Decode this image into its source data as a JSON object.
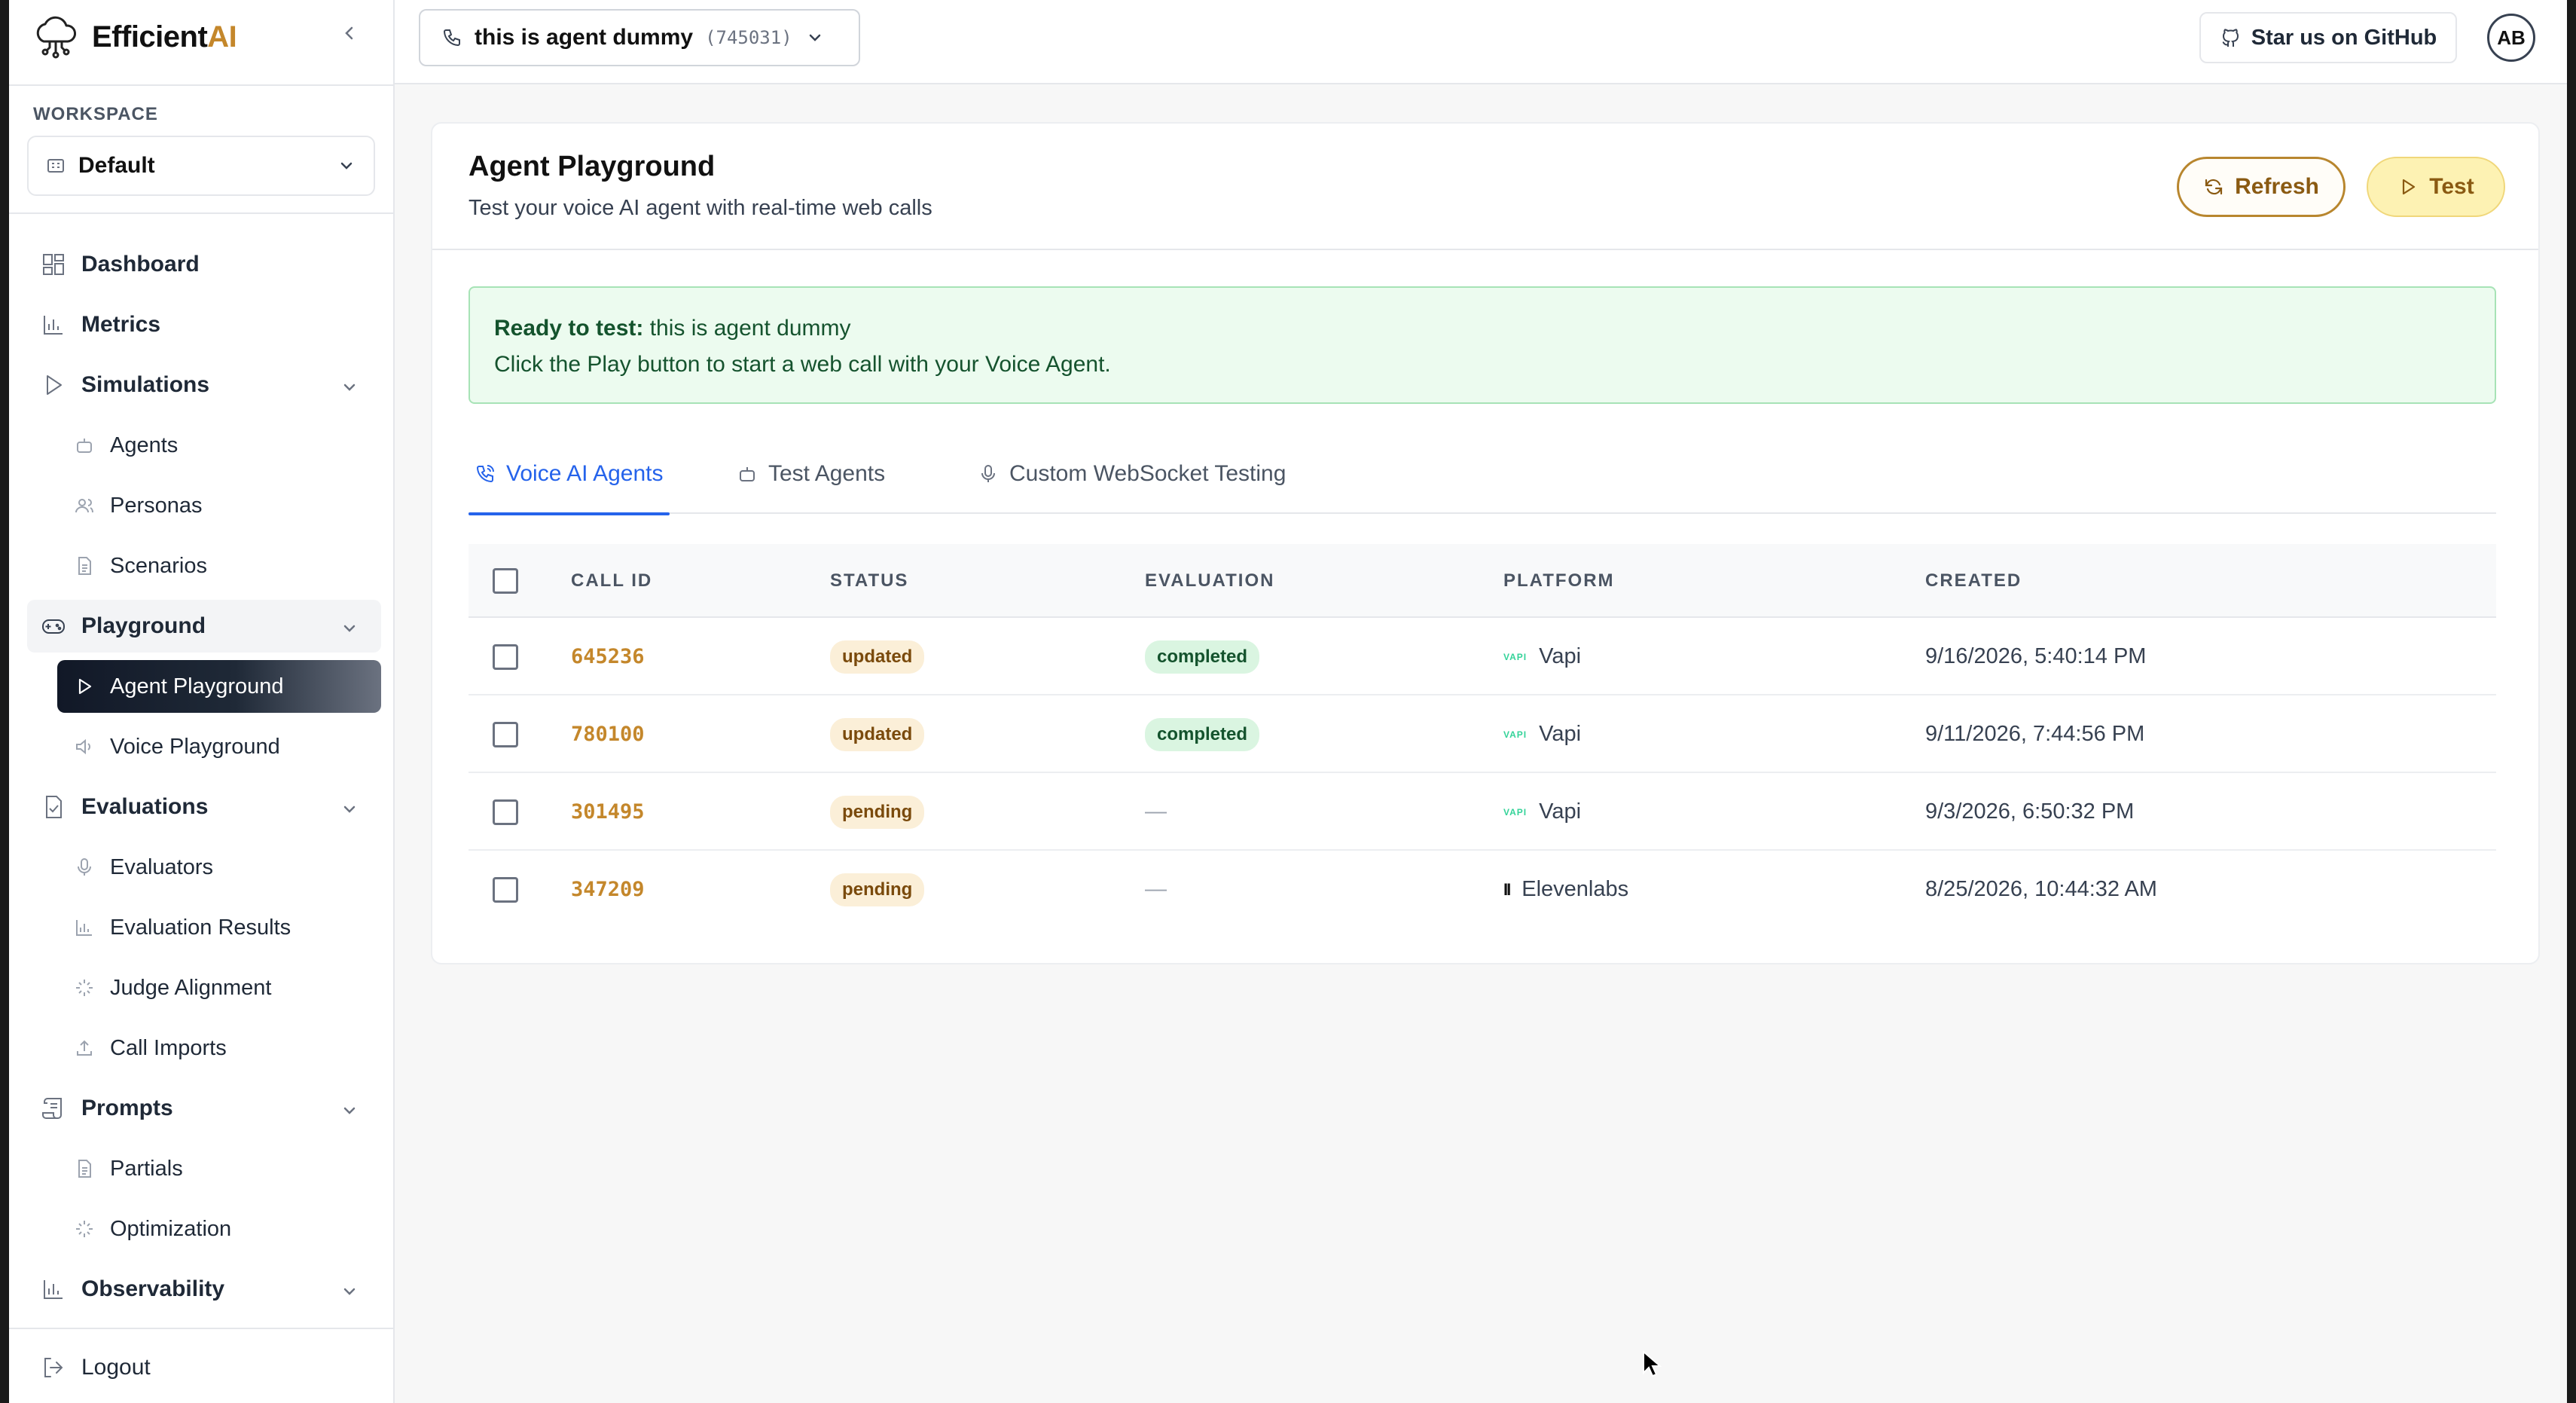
{
  "brand": {
    "name_prefix": "Efficient",
    "name_suffix": "AI"
  },
  "workspace": {
    "label": "WORKSPACE",
    "selected": "Default"
  },
  "sidebar": {
    "items": [
      {
        "label": "Dashboard"
      },
      {
        "label": "Metrics"
      },
      {
        "label": "Simulations"
      },
      {
        "label": "Agents"
      },
      {
        "label": "Personas"
      },
      {
        "label": "Scenarios"
      },
      {
        "label": "Playground"
      },
      {
        "label": "Agent Playground"
      },
      {
        "label": "Voice Playground"
      },
      {
        "label": "Evaluations"
      },
      {
        "label": "Evaluators"
      },
      {
        "label": "Evaluation Results"
      },
      {
        "label": "Judge Alignment"
      },
      {
        "label": "Call Imports"
      },
      {
        "label": "Prompts"
      },
      {
        "label": "Partials"
      },
      {
        "label": "Optimization"
      },
      {
        "label": "Observability"
      }
    ],
    "logout": "Logout"
  },
  "topbar": {
    "agent_name": "this is agent dummy",
    "agent_id": "(745031)",
    "github": "Star us on GitHub",
    "avatar": "AB"
  },
  "page": {
    "title": "Agent Playground",
    "subtitle": "Test your voice AI agent with real-time web calls",
    "refresh": "Refresh",
    "test": "Test"
  },
  "alert": {
    "bold": "Ready to test:",
    "agent": " this is agent dummy",
    "message": "Click the Play button to start a web call with your Voice Agent."
  },
  "tabs": [
    {
      "label": "Voice AI Agents"
    },
    {
      "label": "Test Agents"
    },
    {
      "label": "Custom WebSocket Testing"
    }
  ],
  "table": {
    "headers": {
      "call_id": "CALL ID",
      "status": "STATUS",
      "evaluation": "EVALUATION",
      "platform": "PLATFORM",
      "created": "CREATED"
    },
    "rows": [
      {
        "call_id": "645236",
        "status": "updated",
        "evaluation": "completed",
        "platform": "Vapi",
        "platform_logo": "VAPI",
        "created": "9/16/2026, 5:40:14 PM"
      },
      {
        "call_id": "780100",
        "status": "updated",
        "evaluation": "completed",
        "platform": "Vapi",
        "platform_logo": "VAPI",
        "created": "9/11/2026, 7:44:56 PM"
      },
      {
        "call_id": "301495",
        "status": "pending",
        "evaluation": "—",
        "platform": "Vapi",
        "platform_logo": "VAPI",
        "created": "9/3/2026, 6:50:32 PM"
      },
      {
        "call_id": "347209",
        "status": "pending",
        "evaluation": "—",
        "platform": "Elevenlabs",
        "platform_logo": "II",
        "created": "8/25/2026, 10:44:32 AM"
      }
    ]
  },
  "colors": {
    "brand_accent": "#c4872b",
    "tab_active": "#2563eb",
    "alert_bg": "#ecfbef"
  }
}
